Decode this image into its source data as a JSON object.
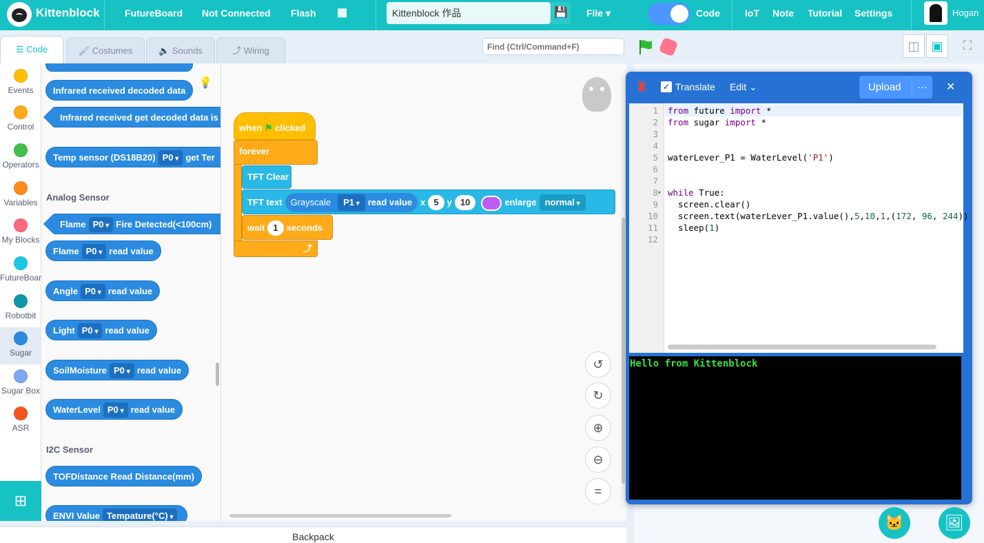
{
  "topbar": {
    "brand": "Kittenblock",
    "device": "FutureBoard",
    "connection": "Not Connected",
    "flash": "Flash",
    "project_title": "Kittenblock 作品",
    "file": "File ▾",
    "code_toggle": "Code",
    "iot": "IoT",
    "note": "Note",
    "tutorial": "Tutorial",
    "settings": "Settings",
    "user": "Hogan"
  },
  "tabs": {
    "code": "Code",
    "costumes": "Costumes",
    "sounds": "Sounds",
    "wiring": "Wiring"
  },
  "find_placeholder": "Find (Ctrl/Command+F)",
  "categories": [
    {
      "label": "Events",
      "color": "#ffbf00"
    },
    {
      "label": "Control",
      "color": "#ffab19"
    },
    {
      "label": "Operators",
      "color": "#40bf4a"
    },
    {
      "label": "Variables",
      "color": "#ff8c1a"
    },
    {
      "label": "My Blocks",
      "color": "#ff6680"
    },
    {
      "label": "FutureBoar",
      "color": "#1bc8e8"
    },
    {
      "label": "Robotbit",
      "color": "#0e97a8"
    },
    {
      "label": "Sugar",
      "color": "#2a8be0"
    },
    {
      "label": "Sugar Box",
      "color": "#7ea6f2"
    },
    {
      "label": "ASR",
      "color": "#f5541c"
    }
  ],
  "palette": {
    "ir_decoded": "Infrared received decoded data",
    "ir_get_decoded": "Infrared received get decoded data is e",
    "temp_label": "Temp sensor (DS18B20)",
    "temp_port": "P0",
    "temp_get": "get Ter",
    "analog_section": "Analog Sensor",
    "flame_label": "Flame",
    "flame_port": "P0",
    "flame_detected": "Fire Detected(<100cm)",
    "flame2_port": "P0",
    "read_value": "read value",
    "angle_label": "Angle",
    "angle_port": "P0",
    "light_label": "Light",
    "light_port": "P0",
    "soil_label": "SoilMoisture",
    "soil_port": "P0",
    "water_label": "WaterLevel",
    "water_port": "P0",
    "i2c_section": "I2C Sensor",
    "tof": "TOFDistance Read Distance(mm)",
    "envi_label": "ENVI Value",
    "envi_field": "Tempature(°C)"
  },
  "script": {
    "when": "when",
    "clicked": "clicked",
    "forever": "forever",
    "tft_clear": "TFT Clear",
    "tft_text": "TFT text",
    "grayscale": "Grayscale",
    "port": "P1",
    "read_value": "read value",
    "x_label": "x",
    "x_val": "5",
    "y_label": "y",
    "y_val": "10",
    "text_color": "#bf5cf5",
    "enlarge": "enlarge",
    "size": "normal",
    "wait": "wait",
    "wait_val": "1",
    "seconds": "seconds"
  },
  "code_panel": {
    "translate": "Translate",
    "edit": "Edit",
    "upload": "Upload",
    "more": "···",
    "close": "✕",
    "line_numbers": [
      "1",
      "2",
      "3",
      "4",
      "5",
      "6",
      "7",
      "8",
      "9",
      "10",
      "11",
      "12"
    ],
    "console_output": "Hello from Kittenblock"
  },
  "backpack": "Backpack"
}
